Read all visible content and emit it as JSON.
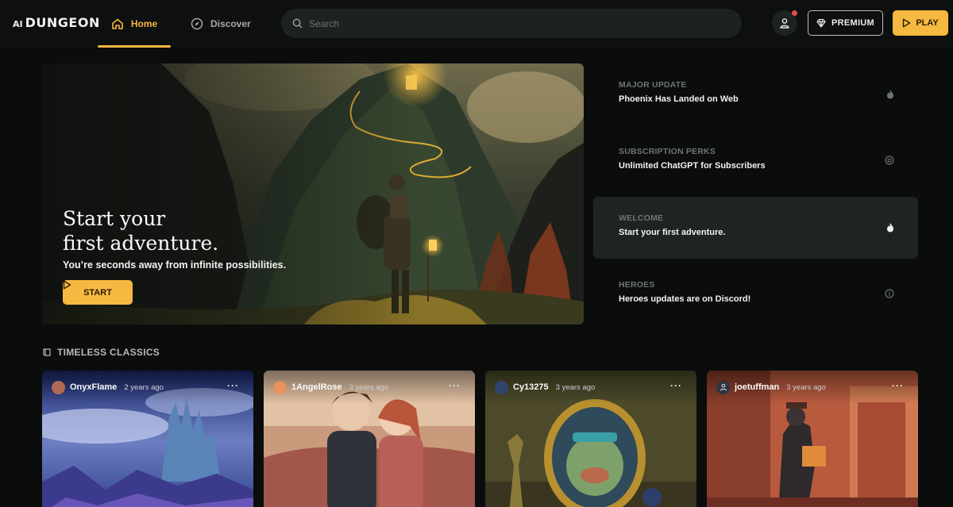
{
  "logo": {
    "ai": "AI",
    "name": "DUNGEON"
  },
  "nav": {
    "home": "Home",
    "discover": "Discover"
  },
  "search": {
    "placeholder": "Search"
  },
  "header": {
    "premium_label": "PREMIUM",
    "play_label": "PLAY"
  },
  "hero": {
    "title_line1": "Start your",
    "title_line2": "first adventure.",
    "subtitle": "You’re seconds away from infinite possibilities.",
    "start_label": "START"
  },
  "news": [
    {
      "category": "MAJOR UPDATE",
      "title": "Phoenix Has Landed on Web",
      "icon": "flame-icon"
    },
    {
      "category": "SUBSCRIPTION PERKS",
      "title": "Unlimited ChatGPT for Subscribers",
      "icon": "badge-icon"
    },
    {
      "category": "WELCOME",
      "title": "Start your first adventure.",
      "icon": "flame-icon"
    },
    {
      "category": "HEROES",
      "title": "Heroes updates are on Discord!",
      "icon": "info-icon"
    }
  ],
  "section": {
    "title": "TIMELESS CLASSICS"
  },
  "cards": [
    {
      "user": "OnyxFlame",
      "ago": "2 years ago"
    },
    {
      "user": "1AngelRose",
      "ago": "3 years ago"
    },
    {
      "user": "Cy13275",
      "ago": "3 years ago"
    },
    {
      "user": "joetuffman",
      "ago": "3 years ago"
    }
  ],
  "colors": {
    "accent": "#f5b841",
    "background": "#0b0c0c",
    "active_row": "#1f2323"
  }
}
